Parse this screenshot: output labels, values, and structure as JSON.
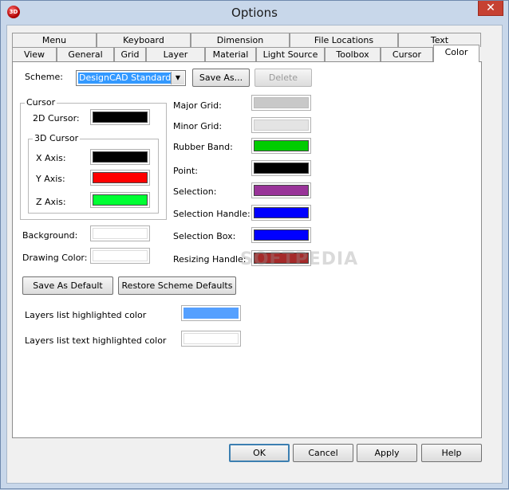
{
  "window": {
    "title": "Options",
    "close_glyph": "✕",
    "app_icon_text": "3D"
  },
  "tabs_row1": [
    "Menu",
    "Keyboard",
    "Dimension",
    "File Locations",
    "Text"
  ],
  "tabs_row2": [
    "View",
    "General",
    "Grid",
    "Layer",
    "Material",
    "Light Source",
    "Toolbox",
    "Cursor",
    "Color"
  ],
  "active_tab": "Color",
  "scheme": {
    "label": "Scheme:",
    "value": "DesignCAD Standard (W",
    "save_as": "Save As...",
    "delete": "Delete"
  },
  "cursor_group": {
    "title": "Cursor",
    "cursor_2d_label": "2D Cursor:",
    "cursor_2d_color": "#000000",
    "cursor_3d_title": "3D Cursor",
    "x_axis_label": "X Axis:",
    "x_axis_color": "#000000",
    "y_axis_label": "Y Axis:",
    "y_axis_color": "#ff0000",
    "z_axis_label": "Z Axis:",
    "z_axis_color": "#00ff33"
  },
  "background": {
    "label": "Background:",
    "color": "#ffffff"
  },
  "drawing_color": {
    "label": "Drawing Color:",
    "color": "#ffffff"
  },
  "right_colors": [
    {
      "label": "Major Grid:",
      "color": "#c8c8c8"
    },
    {
      "label": "Minor Grid:",
      "color": "#e4e4e4"
    },
    {
      "label": "Rubber Band:",
      "color": "#00cc00"
    },
    {
      "label": "Point:",
      "color": "#000000"
    },
    {
      "label": "Selection:",
      "color": "#993399"
    },
    {
      "label": "Selection Handle:",
      "color": "#0000ff"
    },
    {
      "label": "Selection Box:",
      "color": "#0000ff"
    },
    {
      "label": "Resizing Handle:",
      "color": "#a52a2a"
    }
  ],
  "actions": {
    "save_default": "Save As Default",
    "restore_defaults": "Restore Scheme Defaults"
  },
  "layers": {
    "highlight_label": "Layers list highlighted color",
    "highlight_color": "#55a0ff",
    "text_highlight_label": "Layers list text highlighted color",
    "text_highlight_color": "#ffffff"
  },
  "dialog_buttons": {
    "ok": "OK",
    "cancel": "Cancel",
    "apply": "Apply",
    "help": "Help"
  },
  "watermark": "SOFTPEDIA"
}
